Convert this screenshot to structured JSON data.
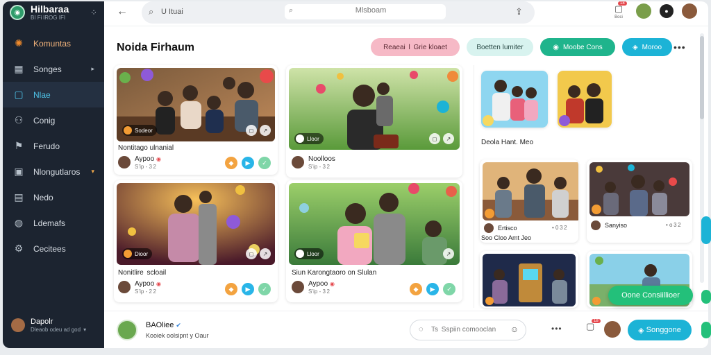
{
  "sidebar": {
    "brand_title": "Hilbaraa",
    "brand_subtitle": "BI Fi IROG IFI",
    "menu_icon": "dots-icon",
    "items": [
      {
        "label": "Komuntas",
        "icon": "gear-icon",
        "chevron": ""
      },
      {
        "label": "Songes",
        "icon": "grid-icon",
        "chevron": "▸"
      },
      {
        "label": "Nlae",
        "icon": "square-icon",
        "chevron": ""
      },
      {
        "label": "Conig",
        "icon": "user-icon",
        "chevron": ""
      },
      {
        "label": "Ferudo",
        "icon": "flag-icon",
        "chevron": ""
      },
      {
        "label": "Nlongutlaros",
        "icon": "image-icon",
        "chevron": "▾"
      },
      {
        "label": "Nedo",
        "icon": "card-icon",
        "chevron": ""
      },
      {
        "label": "Ldemafs",
        "icon": "pin-icon",
        "chevron": ""
      },
      {
        "label": "Cecitees",
        "icon": "gear-icon",
        "chevron": ""
      }
    ],
    "user_name": "Dapolr",
    "user_sub": "Dleaob odeu ad god"
  },
  "topbar": {
    "search_text": "U Ituai",
    "inner_placeholder": "Mlsboam",
    "notif_label": "Boci",
    "notif_count": "18"
  },
  "page": {
    "title": "Noida Firhaum",
    "chips": [
      "Reaeai  l  Grie kloaet",
      "Boetten lumiter",
      "Moobe Cons",
      "Moroo"
    ]
  },
  "cards": [
    {
      "badge": "Sodeor",
      "caption": "Nontitago ulnanial",
      "author": "Aypoo",
      "sub": "S’ip - 3 2"
    },
    {
      "badge": "Lloor",
      "caption": "",
      "author": "Noolloos",
      "sub": "S’ip - 3 2"
    },
    {
      "badge": "Dioor",
      "caption": "Nonitlire  scloail",
      "author": "Aypoo",
      "sub": "S’ip - 2 2"
    },
    {
      "badge": "Lloor",
      "caption": "Siun Karongtaoro on Slulan",
      "author": "Aypoo",
      "sub": "S’ip - 3 2"
    }
  ],
  "right": {
    "caption_top": "Deola Hant. Meo",
    "c1_author": "Ertisco",
    "c1_meta": "• 0 3 2",
    "c1_sub": "Soo Cloo Amt Jeo",
    "c2_author": "Sanyiso",
    "c2_meta": "• o 3 2",
    "float_button": "Oone Consiillioer"
  },
  "bottom": {
    "name": "BAOliee",
    "verified": "✔",
    "sub": "Kooiek oolsipnt y Oaur",
    "comment_placeholder": "Ts  Sspiin comooclan",
    "notif_count": "18",
    "primary_button": "Songgone"
  },
  "colors": {
    "sidebar_bg": "#1c2430",
    "accent_cyan": "#1cb3d6",
    "accent_green": "#23c07a",
    "chip_pink": "#f6b9c6"
  }
}
